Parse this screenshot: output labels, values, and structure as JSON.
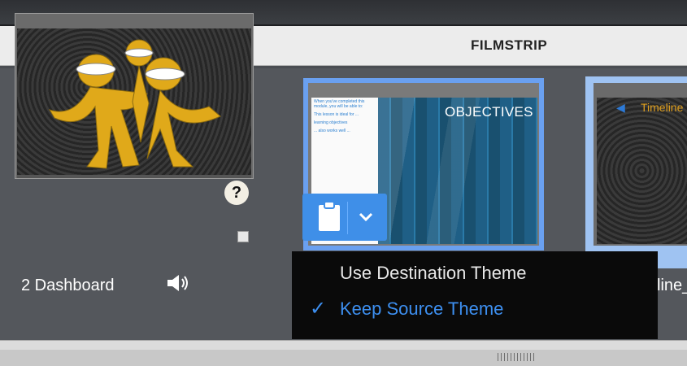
{
  "header": {
    "title": "FILMSTRIP"
  },
  "filmstrip": {
    "slides": [
      {
        "label": "2 Dashboard",
        "help_glyph": "?"
      },
      {
        "heading": "OBJECTIVES",
        "body_lines": [
          "When you've completed this module, you will be able to:",
          "This lesson is ideal for ...",
          "learning objectives",
          "... also works well ..."
        ]
      },
      {
        "heading": "Timeline",
        "partial_label": "line_"
      }
    ]
  },
  "paste_options": {
    "menu_items": [
      {
        "label": "Use Destination Theme",
        "checked": false
      },
      {
        "label": "Keep Source Theme",
        "checked": true
      }
    ]
  },
  "colors": {
    "accent": "#3f8fe8",
    "menu_bg": "#0a0a0a",
    "checked_text": "#3d8ff0"
  }
}
